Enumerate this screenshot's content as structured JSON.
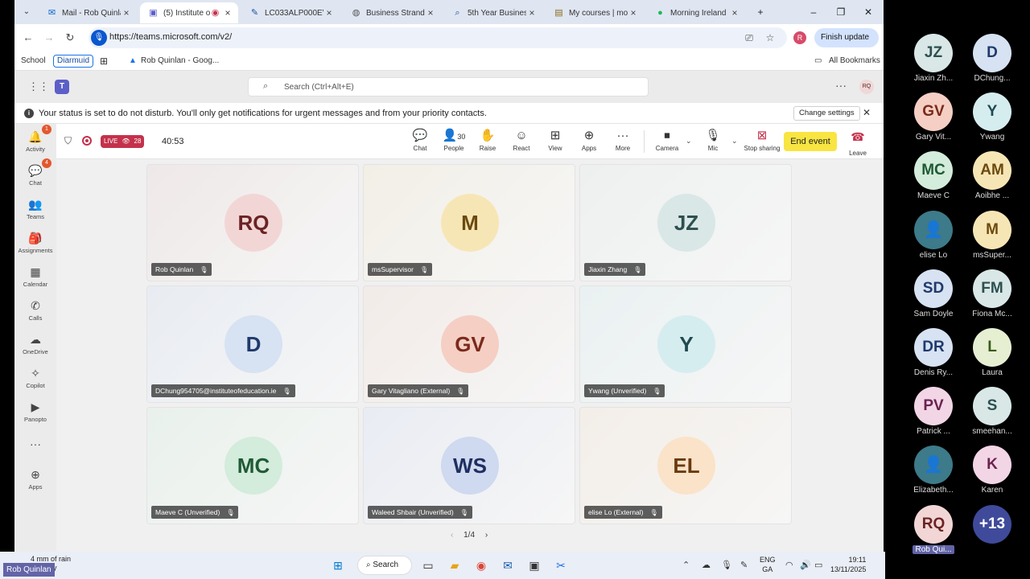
{
  "browser": {
    "tabs": [
      {
        "title": "Mail - Rob Quinlan",
        "icon": "outlook-icon",
        "active": false
      },
      {
        "title": "(5) Institute of",
        "icon": "teams-icon",
        "active": true
      },
      {
        "title": "LC033ALP000EV.p",
        "icon": "pdf-icon",
        "active": false
      },
      {
        "title": "Business Strand 1",
        "icon": "globe-icon",
        "active": false
      },
      {
        "title": "5th Year Business",
        "icon": "search-icon",
        "active": false
      },
      {
        "title": "My courses | moo",
        "icon": "moodle-icon",
        "active": false
      },
      {
        "title": "Morning Ireland |",
        "icon": "spotify-icon",
        "active": false
      }
    ],
    "url": "https://teams.microsoft.com/v2/",
    "profile_initial": "R",
    "finish_update_label": "Finish update",
    "bookmarks": [
      "School",
      "Diarmuid",
      "Rob Quinlan - Goog..."
    ],
    "all_bookmarks_label": "All Bookmarks"
  },
  "teams": {
    "search_placeholder": "Search (Ctrl+Alt+E)",
    "me_initials": "RQ",
    "status_message": "Your status is set to do not disturb. You'll only get notifications for urgent messages and from your priority contacts.",
    "change_settings_label": "Change settings",
    "rail": [
      {
        "label": "Activity",
        "icon": "bell-icon",
        "badge": "1"
      },
      {
        "label": "Chat",
        "icon": "chat-icon",
        "badge": "4"
      },
      {
        "label": "Teams",
        "icon": "teams-group-icon",
        "badge": ""
      },
      {
        "label": "Assignments",
        "icon": "backpack-icon",
        "badge": ""
      },
      {
        "label": "Calendar",
        "icon": "calendar-icon",
        "badge": ""
      },
      {
        "label": "Calls",
        "icon": "phone-icon",
        "badge": ""
      },
      {
        "label": "OneDrive",
        "icon": "cloud-icon",
        "badge": ""
      },
      {
        "label": "Copilot",
        "icon": "copilot-icon",
        "badge": ""
      },
      {
        "label": "Panopto",
        "icon": "panopto-icon",
        "badge": ""
      },
      {
        "label": "",
        "icon": "more-icon",
        "badge": ""
      },
      {
        "label": "Apps",
        "icon": "plus-icon",
        "badge": ""
      }
    ],
    "meeting": {
      "live_label": "LIVE",
      "viewers": "28",
      "timer": "40:53",
      "people_count": "30",
      "controls": [
        "Chat",
        "People",
        "Raise",
        "React",
        "View",
        "Apps",
        "More",
        "Camera",
        "Mic",
        "Stop sharing"
      ],
      "end_event_label": "End event",
      "leave_label": "Leave"
    },
    "tiles": [
      {
        "initials": "RQ",
        "name": "Rob Quinlan",
        "bg": "#f2d6d6",
        "fg": "#6b2323"
      },
      {
        "initials": "M",
        "name": "msSupervisor",
        "bg": "#f7e6b5",
        "fg": "#6b4a10"
      },
      {
        "initials": "JZ",
        "name": "Jiaxin Zhang",
        "bg": "#d9e7e7",
        "fg": "#2d4f4f"
      },
      {
        "initials": "D",
        "name": "DChung954705@instituteofeducation.ie",
        "bg": "#d7e2f2",
        "fg": "#1f3a6b"
      },
      {
        "initials": "GV",
        "name": "Gary Vitagliano (External)",
        "bg": "#f5cfc4",
        "fg": "#7a2a1a"
      },
      {
        "initials": "Y",
        "name": "Ywang (Unverified)",
        "bg": "#d6edf0",
        "fg": "#1f4a50"
      },
      {
        "initials": "MC",
        "name": "Maeve C (Unverified)",
        "bg": "#d3ecdb",
        "fg": "#1f5a35"
      },
      {
        "initials": "WS",
        "name": "Waleed Shbair (Unverified)",
        "bg": "#cfd9ef",
        "fg": "#1f2f60"
      },
      {
        "initials": "EL",
        "name": "elise Lo (External)",
        "bg": "#fae3c8",
        "fg": "#6b3a10"
      }
    ],
    "pager": "1/4"
  },
  "gallery": [
    {
      "initials": "JZ",
      "name": "Jiaxin Zh...",
      "bg": "#d9e7e7",
      "fg": "#2d4f4f"
    },
    {
      "initials": "D",
      "name": "DChung...",
      "bg": "#d7e2f2",
      "fg": "#1f3a6b"
    },
    {
      "initials": "GV",
      "name": "Gary Vit...",
      "bg": "#f5cfc4",
      "fg": "#7a2a1a"
    },
    {
      "initials": "Y",
      "name": "Ywang",
      "bg": "#d6edf0",
      "fg": "#1f4a50"
    },
    {
      "initials": "MC",
      "name": "Maeve C",
      "bg": "#d3ecdb",
      "fg": "#1f5a35"
    },
    {
      "initials": "AM",
      "name": "Aoibhe ...",
      "bg": "#f7e6b5",
      "fg": "#6b4a10"
    },
    {
      "initials": "",
      "name": "elise Lo",
      "bg": "#3d7a8a",
      "fg": "#ffffff"
    },
    {
      "initials": "M",
      "name": "msSuper...",
      "bg": "#f7e6b5",
      "fg": "#6b4a10"
    },
    {
      "initials": "SD",
      "name": "Sam Doyle",
      "bg": "#d7e2f2",
      "fg": "#1f3a6b"
    },
    {
      "initials": "FM",
      "name": "Fiona Mc...",
      "bg": "#d9e7e7",
      "fg": "#2d4f4f"
    },
    {
      "initials": "DR",
      "name": "Denis Ry...",
      "bg": "#d7e2f2",
      "fg": "#1f3a6b"
    },
    {
      "initials": "L",
      "name": "Laura",
      "bg": "#e6efd2",
      "fg": "#3a5a1a"
    },
    {
      "initials": "PV",
      "name": "Patrick ...",
      "bg": "#f2d6e6",
      "fg": "#6b2350"
    },
    {
      "initials": "S",
      "name": "smeehan...",
      "bg": "#d9e7e7",
      "fg": "#2d4f4f"
    },
    {
      "initials": "",
      "name": "Elizabeth...",
      "bg": "#3d7a8a",
      "fg": "#ffffff"
    },
    {
      "initials": "K",
      "name": "Karen",
      "bg": "#f2d6e6",
      "fg": "#6b2350"
    },
    {
      "initials": "RQ",
      "name": "Rob Qui...",
      "bg": "#f2d6d6",
      "fg": "#6b2323"
    },
    {
      "initials": "+13",
      "name": "",
      "bg": "#3f4a9a",
      "fg": "#ffffff"
    }
  ],
  "taskbar": {
    "weather_line1": "4 mm of rain",
    "weather_line2": "y",
    "search_label": "Search",
    "lang_line1": "ENG",
    "lang_line2": "GA",
    "time": "19:11",
    "date": "13/11/2025"
  },
  "presenter_label": "Rob Quinlan"
}
